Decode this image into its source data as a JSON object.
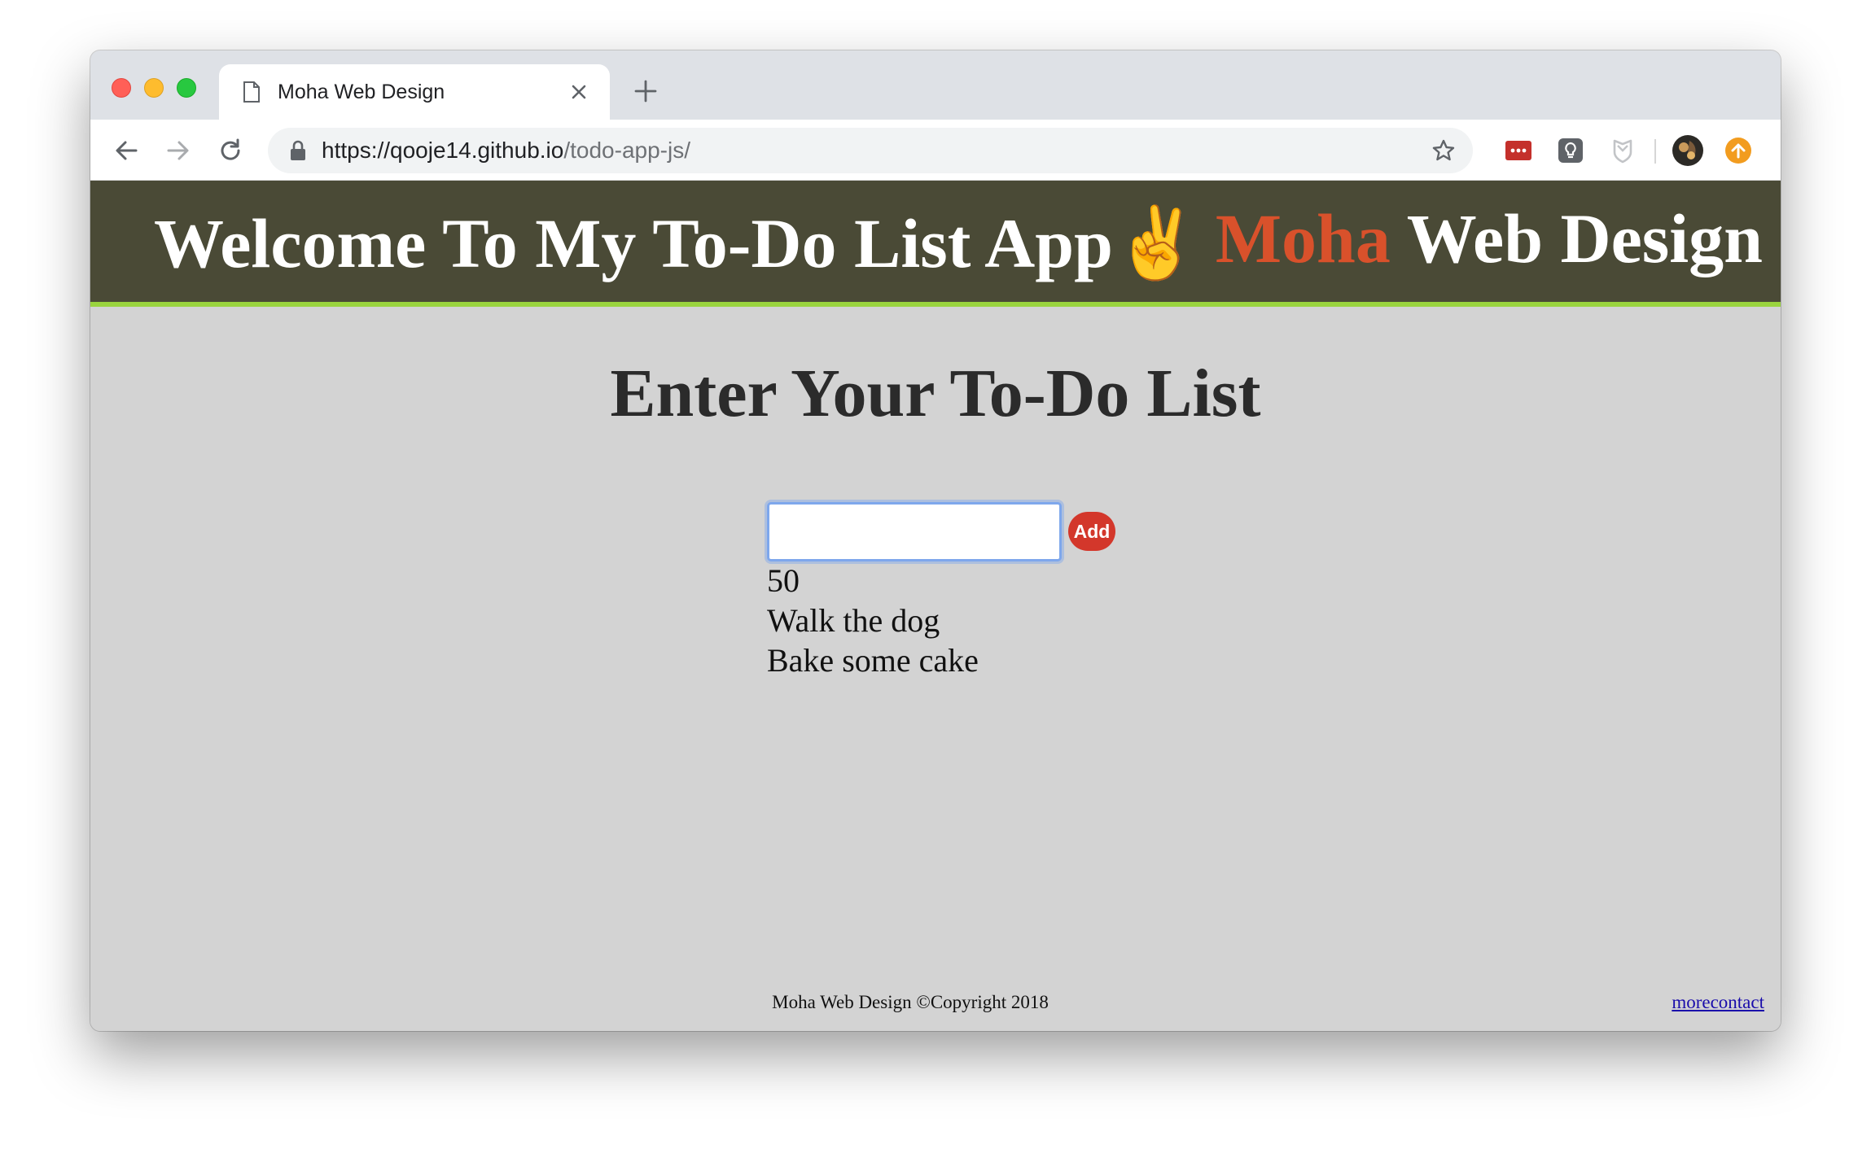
{
  "browser": {
    "tab": {
      "title": "Moha Web Design",
      "page_icon": "page-icon",
      "close_icon": "close-icon"
    },
    "new_tab_icon": "plus-icon",
    "nav": {
      "back_icon": "back-arrow-icon",
      "forward_icon": "forward-arrow-icon",
      "reload_icon": "reload-icon"
    },
    "address_bar": {
      "lock_icon": "lock-icon",
      "url_main": "https://qooje14.github.io",
      "url_path": "/todo-app-js/",
      "bookmark_icon": "star-icon"
    },
    "extensions": [
      "lastpass-icon",
      "lightbulb-extension-icon",
      "shield-extension-icon",
      "profile-avatar",
      "update-arrow-icon"
    ]
  },
  "header": {
    "welcome": "Welcome To My To-Do List App",
    "welcome_emoji": "✌️",
    "brand_accent": "Moha",
    "brand_rest": " Web Design",
    "colors": {
      "background": "#4a4a36",
      "accent": "#d9512b",
      "underline": "#9ad43e"
    }
  },
  "main": {
    "heading": "Enter Your To-Do List",
    "input": {
      "value": "",
      "placeholder": ""
    },
    "add_label": "Add",
    "add_color": "#d3372b",
    "items": [
      "50",
      "Walk the dog",
      "Bake some cake"
    ]
  },
  "footer": {
    "text": "Moha Web Design ©Copyright 2018",
    "link": "morecontact"
  }
}
